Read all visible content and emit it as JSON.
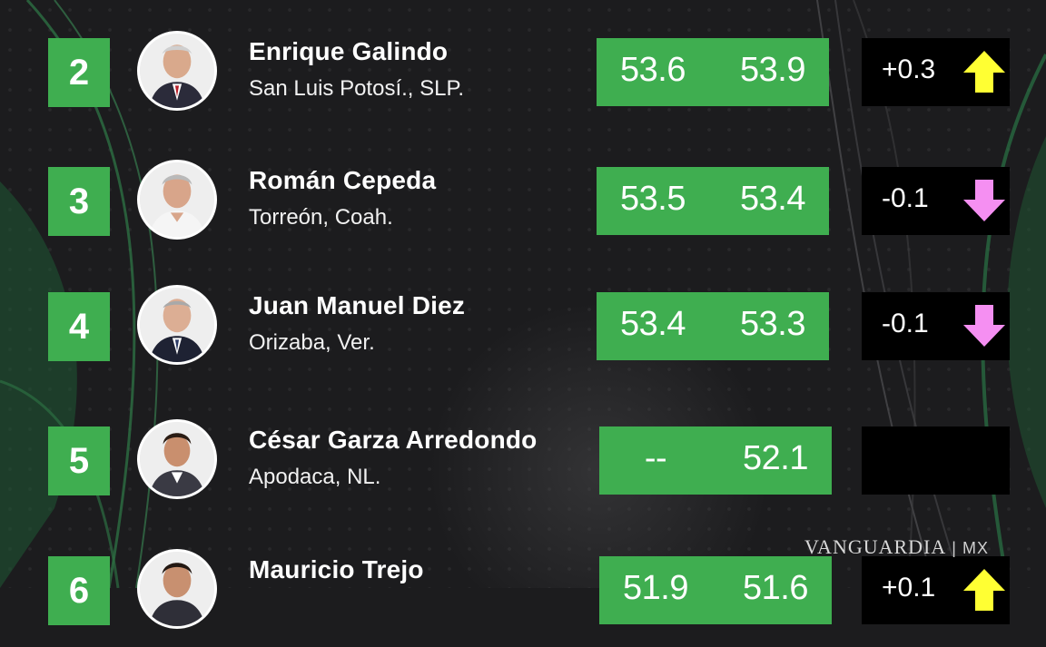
{
  "brand_color": "#3fae50",
  "arrow_up_color": "#ffff33",
  "arrow_down_color": "#f58ff2",
  "rows": [
    {
      "rank": "2",
      "name": "Enrique Galindo",
      "city": "San Luis Potosí., SLP.",
      "prev": "53.6",
      "curr": "53.9",
      "delta": "+0.3",
      "trend": "up"
    },
    {
      "rank": "3",
      "name": "Román Cepeda",
      "city": "Torreón, Coah.",
      "prev": "53.5",
      "curr": "53.4",
      "delta": "-0.1",
      "trend": "down"
    },
    {
      "rank": "4",
      "name": "Juan Manuel Diez",
      "city": "Orizaba, Ver.",
      "prev": "53.4",
      "curr": "53.3",
      "delta": "-0.1",
      "trend": "down"
    },
    {
      "rank": "5",
      "name": "César Garza Arredondo",
      "city": "Apodaca, NL.",
      "prev": "--",
      "curr": "52.1",
      "delta": "",
      "trend": "none"
    },
    {
      "rank": "6",
      "name": "Mauricio Trejo",
      "city": "",
      "prev": "51.9",
      "curr": "51.6",
      "delta": "+0.1",
      "trend": "up"
    }
  ],
  "watermark": {
    "text": "VANGUARDIA",
    "suffix": "MX"
  }
}
